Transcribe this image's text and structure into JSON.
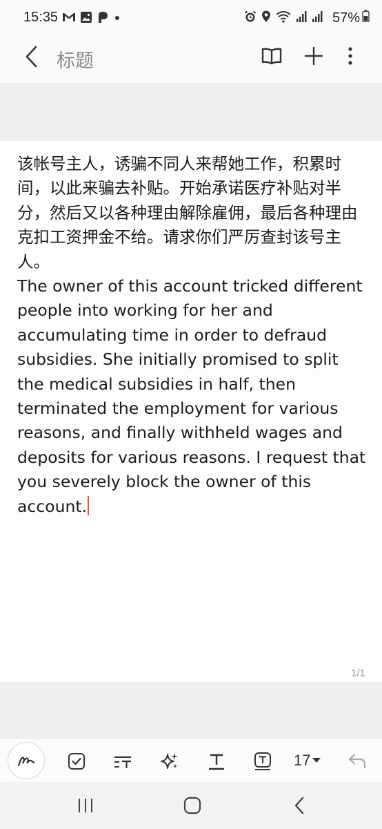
{
  "status_bar": {
    "time": "15:35",
    "battery_percent": "57%",
    "left_icons": [
      "gmail-icon",
      "gallery-icon",
      "app-icon",
      "dot-icon"
    ],
    "right_icons": [
      "alarm-icon",
      "location-icon",
      "wifi-icon",
      "signal-icon",
      "signal-icon-2",
      "battery-icon"
    ]
  },
  "app_bar": {
    "title": "标题"
  },
  "note": {
    "body": "该帐号主人，诱骗不同人来帮她工作，积累时间，以此来骗去补贴。开始承诺医疗补贴对半分，然后又以各种理由解除雇佣，最后各种理由克扣工资押金不给。请求你们严厉查封该号主人。\nThe owner of this account tricked different people into working for her and accumulating time in order to defraud subsidies. She initially promised to split the medical subsidies in half, then terminated the employment for various reasons, and finally withheld wages and deposits for various reasons. I request that you severely block the owner of this account.",
    "page_indicator": "1/1"
  },
  "toolbar": {
    "font_size": "17",
    "accent_color": "#e05a2b"
  }
}
